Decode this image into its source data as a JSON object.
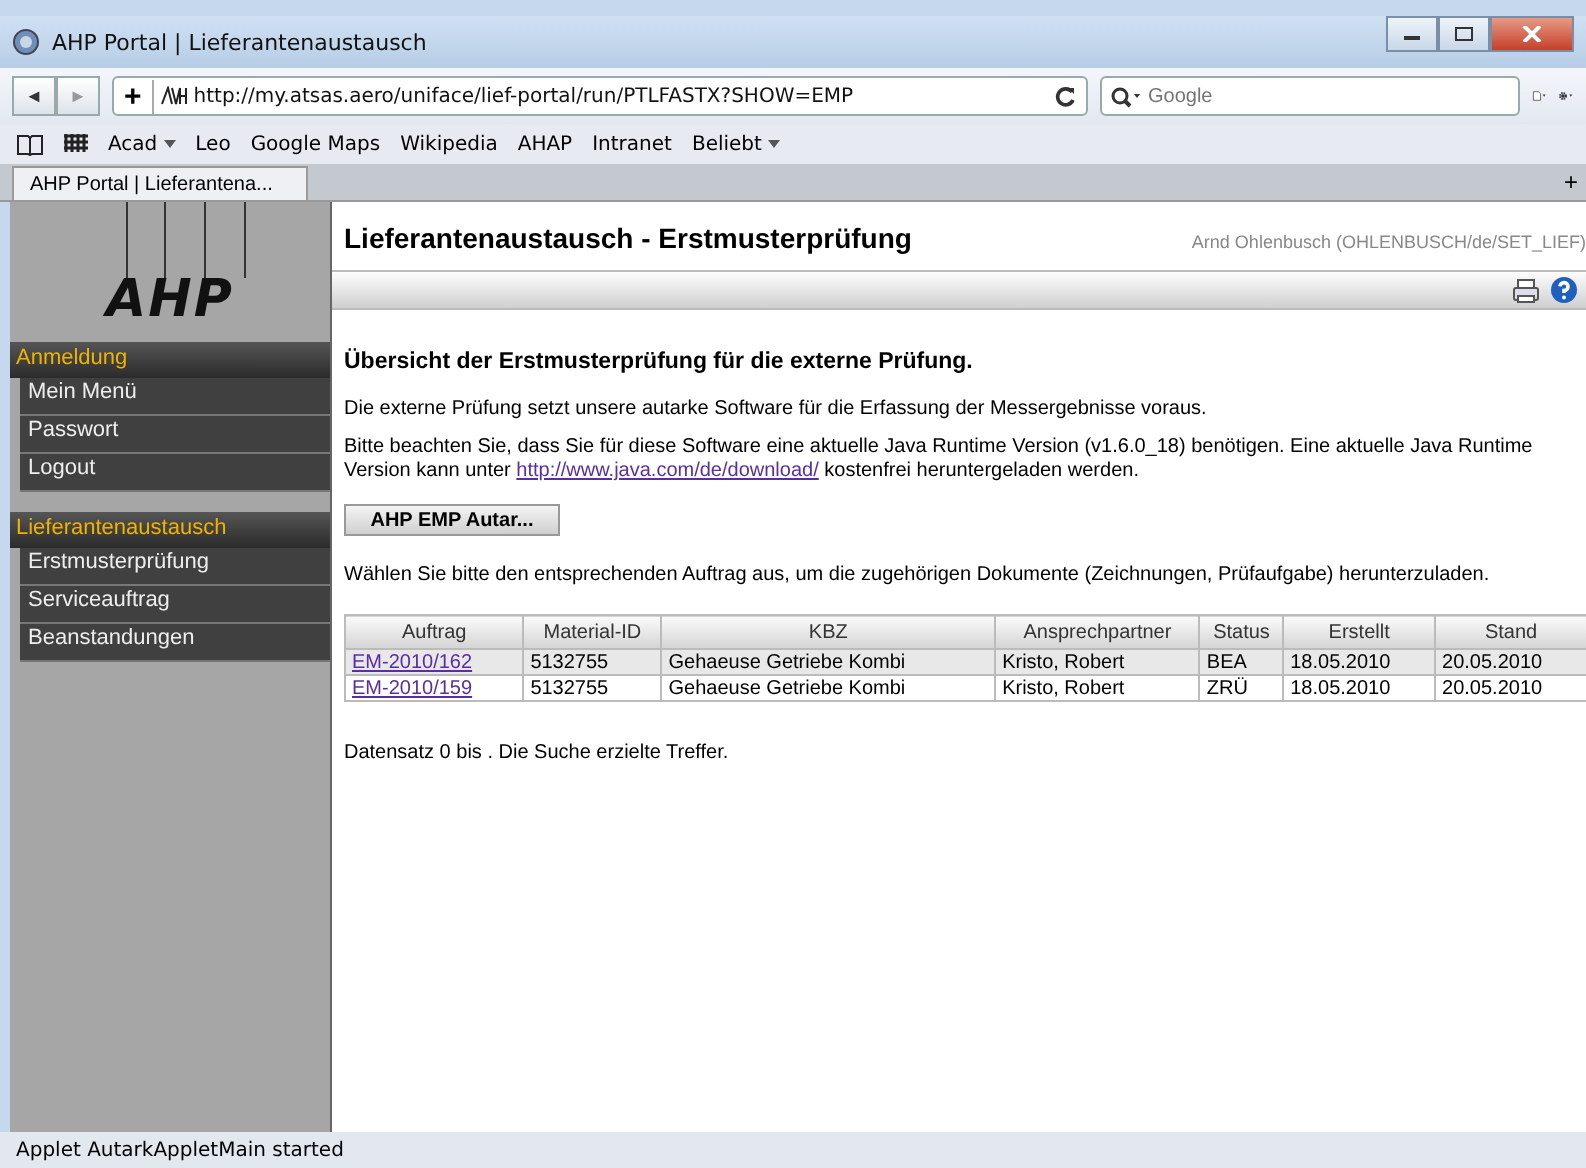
{
  "window": {
    "title": "AHP Portal | Lieferantenaustausch"
  },
  "toolbar": {
    "back": "◄",
    "forward": "►",
    "add": "+",
    "url": "http://my.atsas.aero/uniface/lief-portal/run/PTLFASTX?SHOW=EMP",
    "search_placeholder": "Google"
  },
  "bookmarks": [
    {
      "label": "Acad",
      "dropdown": true
    },
    {
      "label": "Leo",
      "dropdown": false
    },
    {
      "label": "Google Maps",
      "dropdown": false
    },
    {
      "label": "Wikipedia",
      "dropdown": false
    },
    {
      "label": "AHAP",
      "dropdown": false
    },
    {
      "label": "Intranet",
      "dropdown": false
    },
    {
      "label": "Beliebt",
      "dropdown": true
    }
  ],
  "tabs": [
    {
      "label": "AHP Portal | Lieferantena...",
      "selected": true
    }
  ],
  "sidebar": {
    "logo": "AHP",
    "sections": [
      {
        "title": "Anmeldung",
        "items": [
          "Mein Menü",
          "Passwort",
          "Logout"
        ]
      },
      {
        "title": "Lieferantenaustausch",
        "items": [
          "Erstmusterprüfung",
          "Serviceauftrag",
          "Beanstandungen"
        ]
      }
    ]
  },
  "page": {
    "title": "Lieferantenaustausch - Erstmusterprüfung",
    "user": "Arnd Ohlenbusch (OHLENBUSCH/de/SET_LIEF)",
    "heading": "Übersicht der Erstmusterprüfung für die externe Prüfung.",
    "intro": "Die externe Prüfung setzt unsere autarke Software für die Erfassung der Messergebnisse voraus.",
    "java_note_before": "Bitte beachten Sie, dass Sie für diese Software eine aktuelle Java Runtime Version (v1.6.0_18) benötigen. Eine aktuelle Java Runtime Version kann unter",
    "java_link": "http://www.java.com/de/download/",
    "java_note_after": "kostenfrei heruntergeladen werden.",
    "applet_button": "AHP EMP Autar...",
    "instruction": "Wählen Sie bitte den entsprechenden Auftrag aus, um die zugehörigen Dokumente (Zeichnungen, Prüfaufgabe) herunterzuladen.",
    "table": {
      "columns": [
        "Auftrag",
        "Material-ID",
        "KBZ",
        "Ansprechpartner",
        "Status",
        "Erstellt",
        "Stand"
      ],
      "rows": [
        {
          "selected": true,
          "cells": [
            "EM-2010/162",
            "5132755",
            "Gehaeuse Getriebe Kombi",
            "Kristo, Robert",
            "BEA",
            "18.05.2010",
            "20.05.2010"
          ]
        },
        {
          "selected": false,
          "cells": [
            "EM-2010/159",
            "5132755",
            "Gehaeuse Getriebe Kombi",
            "Kristo, Robert",
            "ZRÜ",
            "18.05.2010",
            "20.05.2010"
          ]
        }
      ]
    },
    "footer": "Datensatz 0 bis . Die Suche erzielte Treffer."
  },
  "status_bar": "Applet AutarkAppletMain started"
}
